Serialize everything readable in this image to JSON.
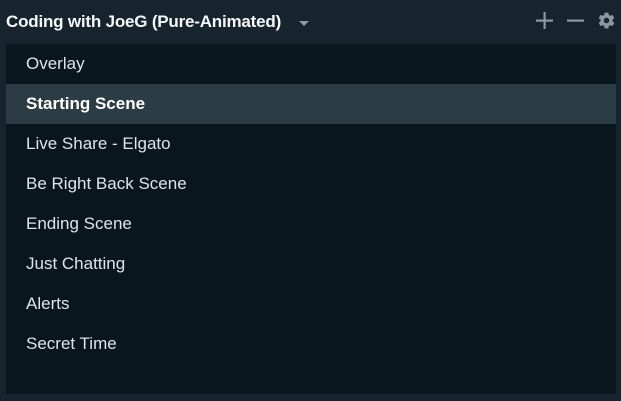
{
  "header": {
    "title": "Coding with JoeG (Pure-Animated)",
    "icons": {
      "dropdown": "chevron-down-icon",
      "add": "plus-icon",
      "remove": "minus-icon",
      "settings": "gear-icon"
    }
  },
  "scenes": {
    "items": [
      {
        "label": "Overlay",
        "selected": false
      },
      {
        "label": "Starting Scene",
        "selected": true
      },
      {
        "label": "Live Share - Elgato",
        "selected": false
      },
      {
        "label": "Be Right Back Scene",
        "selected": false
      },
      {
        "label": "Ending Scene",
        "selected": false
      },
      {
        "label": "Just Chatting",
        "selected": false
      },
      {
        "label": "Alerts",
        "selected": false
      },
      {
        "label": "Secret Time",
        "selected": false
      }
    ]
  },
  "colors": {
    "background": "#17242d",
    "panel": "#09161d",
    "selected_row": "#2c3c45",
    "icon": "#8a99a3"
  }
}
